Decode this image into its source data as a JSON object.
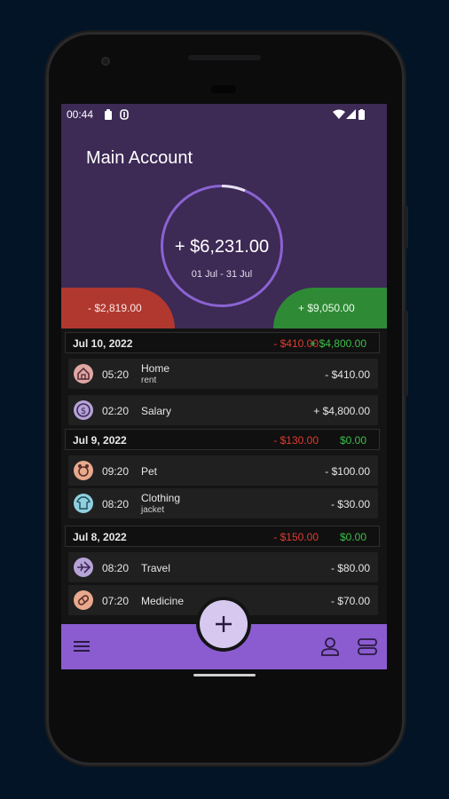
{
  "status": {
    "time": "00:44"
  },
  "account": {
    "title": "Main Account",
    "balance": "+ $6,231.00",
    "period": "01 Jul - 31 Jul"
  },
  "summary": {
    "expense": "- $2,819.00",
    "income": "+ $9,050.00"
  },
  "days": [
    {
      "date": "Jul 10, 2022",
      "expense": "- $410.00",
      "income": "+ $4,800.00"
    },
    {
      "date": "Jul 9, 2022",
      "expense": "- $130.00",
      "income": "$0.00"
    },
    {
      "date": "Jul 8, 2022",
      "expense": "- $150.00",
      "income": "$0.00"
    }
  ],
  "transactions": [
    {
      "icon": "home-icon",
      "time": "05:20",
      "category": "Home",
      "note": "rent",
      "amount": "- $410.00"
    },
    {
      "icon": "salary-icon",
      "time": "02:20",
      "category": "Salary",
      "note": "",
      "amount": "+ $4,800.00"
    },
    {
      "icon": "pet-icon",
      "time": "09:20",
      "category": "Pet",
      "note": "",
      "amount": "- $100.00"
    },
    {
      "icon": "clothing-icon",
      "time": "08:20",
      "category": "Clothing",
      "note": "jacket",
      "amount": "- $30.00"
    },
    {
      "icon": "travel-icon",
      "time": "08:20",
      "category": "Travel",
      "note": "",
      "amount": "- $80.00"
    },
    {
      "icon": "medicine-icon",
      "time": "07:20",
      "category": "Medicine",
      "note": "",
      "amount": "- $70.00"
    }
  ],
  "colors": {
    "hero": "#3d2a55",
    "accent": "#8a5cd0",
    "expense": "#e03b30",
    "income": "#3cbf48",
    "expense_pill": "#b0382f",
    "income_pill": "#2f8a36"
  },
  "fab": {
    "icon": "plus-icon"
  },
  "bottom_nav": {
    "icons": [
      "menu-icon",
      "user-icon",
      "accounts-icon"
    ]
  }
}
